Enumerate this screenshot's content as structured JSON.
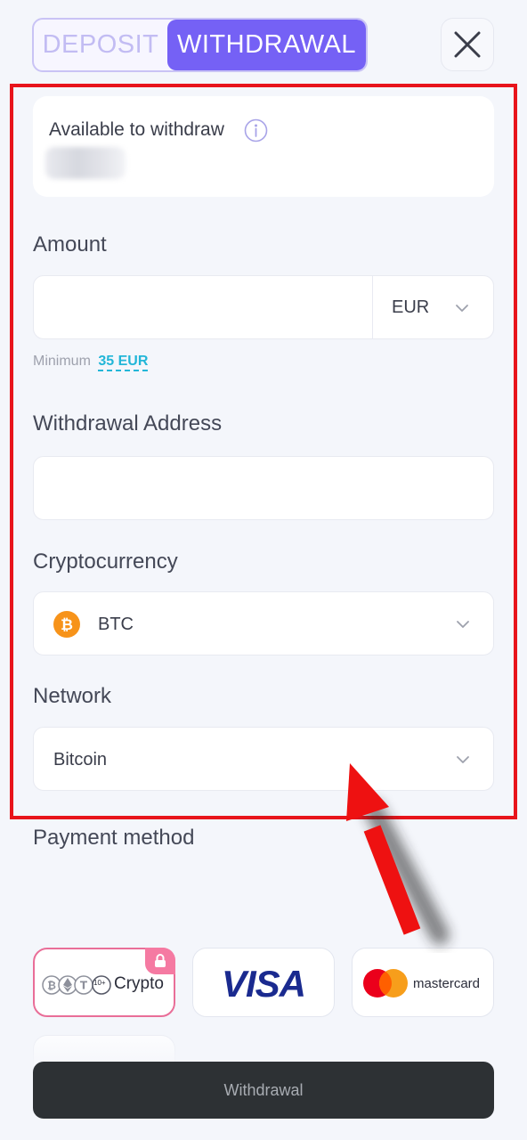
{
  "tabs": {
    "deposit_label": "DEPOSIT",
    "withdrawal_label": "WITHDRAWAL",
    "active": "withdrawal"
  },
  "icons": {
    "close": "close-icon",
    "info": "info-icon",
    "chevron": "chevron-down-icon",
    "btc": "bitcoin-icon",
    "lock": "lock-icon"
  },
  "balance": {
    "label": "Available to withdraw",
    "value_obscured": true
  },
  "amount": {
    "label": "Amount",
    "value": "",
    "currency": "EUR",
    "minimum_label": "Minimum",
    "minimum_value": "35 EUR"
  },
  "address": {
    "label": "Withdrawal Address",
    "value": ""
  },
  "cryptocurrency": {
    "label": "Cryptocurrency",
    "selected": "BTC"
  },
  "network": {
    "label": "Network",
    "selected": "Bitcoin"
  },
  "payment": {
    "label": "Payment method",
    "methods": [
      {
        "label": "Crypto",
        "badge": "10+",
        "selected": true,
        "locked": true
      },
      {
        "label": "VISA",
        "selected": false
      },
      {
        "label": "mastercard",
        "selected": false
      }
    ]
  },
  "submit": {
    "label": "Withdrawal"
  },
  "colors": {
    "accent": "#7561f5",
    "highlight_frame": "#e8141b",
    "minimum_link": "#22b6d8",
    "selected_card_border": "#e96e98",
    "button_bg": "#2d3134"
  }
}
